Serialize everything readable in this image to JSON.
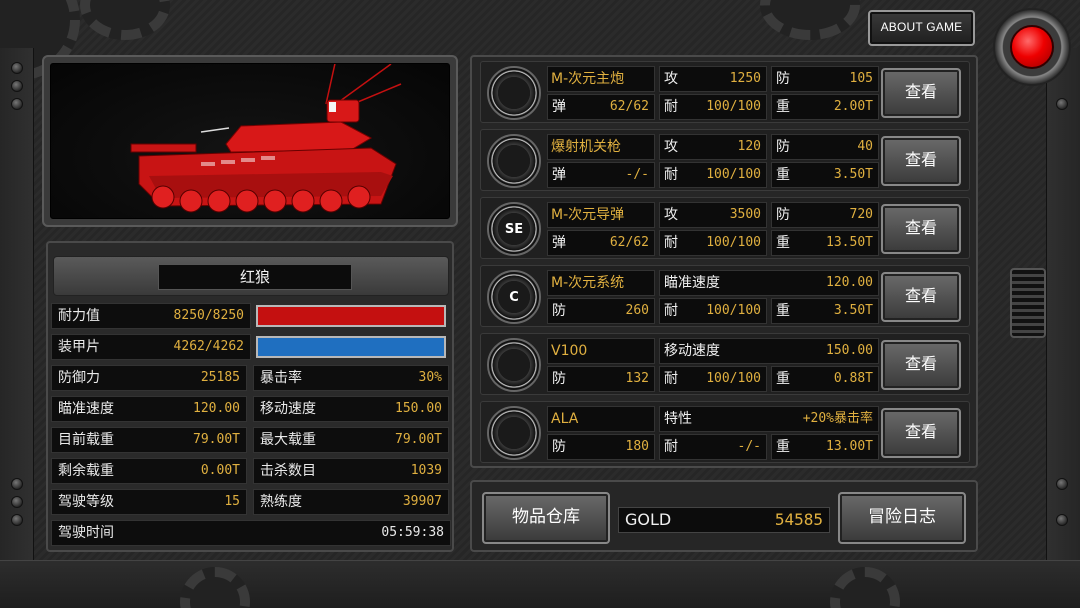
{
  "header": {
    "about_label": "ABOUT GAME",
    "record_icon": "red-round-button"
  },
  "tank": {
    "name": "红狼",
    "image_icon": "red-tank-image",
    "color": "#d81818"
  },
  "stats": {
    "hp": {
      "label": "耐力值",
      "value": "8250/8250",
      "fraction": 1.0,
      "color": "#c41010"
    },
    "armor": {
      "label": "装甲片",
      "value": "4262/4262",
      "fraction": 1.0,
      "color": "#1f6fc0"
    },
    "rows": [
      {
        "l_label": "防御力",
        "l_value": "25185",
        "r_label": "暴击率",
        "r_value": "30%"
      },
      {
        "l_label": "瞄准速度",
        "l_value": "120.00",
        "r_label": "移动速度",
        "r_value": "150.00"
      },
      {
        "l_label": "目前载重",
        "l_value": "79.00T",
        "r_label": "最大载重",
        "r_value": "79.00T"
      },
      {
        "l_label": "剩余载重",
        "l_value": "0.00T",
        "r_label": "击杀数目",
        "r_value": "1039"
      },
      {
        "l_label": "驾驶等级",
        "l_value": "15",
        "r_label": "熟练度",
        "r_value": "39907"
      }
    ],
    "drive_time": {
      "label": "驾驶时间",
      "value": "05:59:38"
    }
  },
  "equipment": [
    {
      "icon": "main-cannon-icon",
      "icon_text": "",
      "name": "M-次元主炮",
      "c1": {
        "label": "攻",
        "value": "1250"
      },
      "c2": {
        "label": "防",
        "value": "105"
      },
      "c3": {
        "label": "弹",
        "value": "62/62"
      },
      "c4": {
        "label": "耐",
        "value": "100/100"
      },
      "c5": {
        "label": "重",
        "value": "2.00T"
      },
      "button": "查看"
    },
    {
      "icon": "machine-gun-icon",
      "icon_text": "",
      "name": "爆射机关枪",
      "c1": {
        "label": "攻",
        "value": "120"
      },
      "c2": {
        "label": "防",
        "value": "40"
      },
      "c3": {
        "label": "弹",
        "value": "-/-"
      },
      "c4": {
        "label": "耐",
        "value": "100/100"
      },
      "c5": {
        "label": "重",
        "value": "3.50T"
      },
      "button": "查看"
    },
    {
      "icon": "missile-se-icon",
      "icon_text": "SE",
      "name": "M-次元导弹",
      "c1": {
        "label": "攻",
        "value": "3500"
      },
      "c2": {
        "label": "防",
        "value": "720"
      },
      "c3": {
        "label": "弹",
        "value": "62/62"
      },
      "c4": {
        "label": "耐",
        "value": "100/100"
      },
      "c5": {
        "label": "重",
        "value": "13.50T"
      },
      "button": "查看"
    },
    {
      "icon": "system-c-icon",
      "icon_text": "C",
      "name": "M-次元系统",
      "wide": {
        "label": "瞄准速度",
        "value": "120.00"
      },
      "c3": {
        "label": "防",
        "value": "260"
      },
      "c4": {
        "label": "耐",
        "value": "100/100"
      },
      "c5": {
        "label": "重",
        "value": "3.50T"
      },
      "button": "查看"
    },
    {
      "icon": "engine-icon",
      "icon_text": "",
      "name": "V100",
      "wide": {
        "label": "移动速度",
        "value": "150.00"
      },
      "c3": {
        "label": "防",
        "value": "132"
      },
      "c4": {
        "label": "耐",
        "value": "100/100"
      },
      "c5": {
        "label": "重",
        "value": "0.88T"
      },
      "button": "查看"
    },
    {
      "icon": "chassis-icon",
      "icon_text": "",
      "name": "ALA",
      "wide": {
        "label": "特性",
        "value": "+20%暴击率"
      },
      "c3": {
        "label": "防",
        "value": "180"
      },
      "c4": {
        "label": "耐",
        "value": "-/-"
      },
      "c5": {
        "label": "重",
        "value": "13.00T"
      },
      "button": "查看"
    }
  ],
  "footer": {
    "inventory_label": "物品仓库",
    "gold_label": "GOLD",
    "gold_value": "54585",
    "log_label": "冒险日志"
  }
}
